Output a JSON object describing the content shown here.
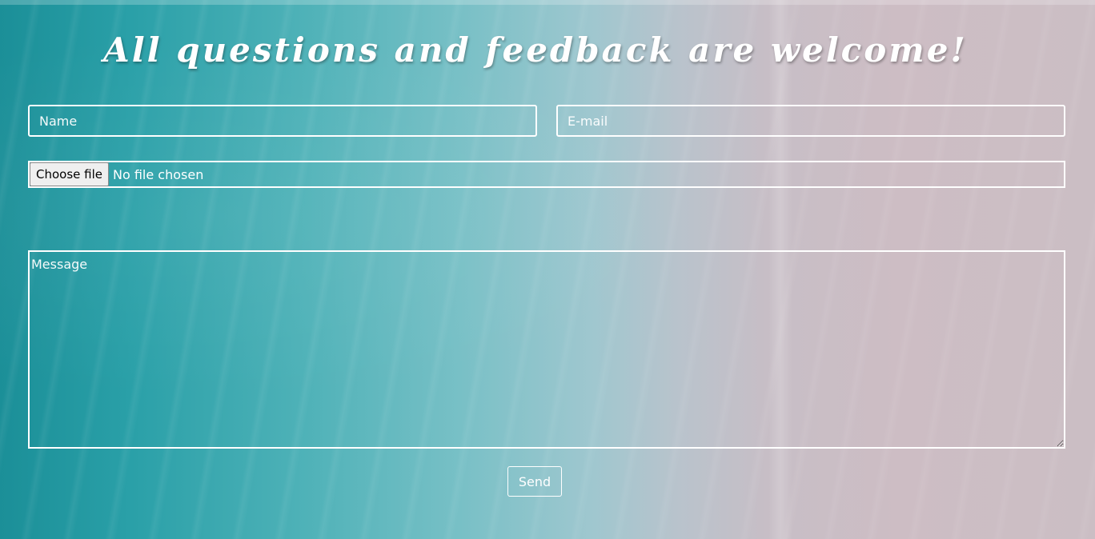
{
  "page": {
    "title": "All questions and feedback are welcome!"
  },
  "form": {
    "name": {
      "placeholder": "Name",
      "value": ""
    },
    "email": {
      "placeholder": "E-mail",
      "value": ""
    },
    "file": {
      "button_label": "Choose file",
      "status": "No file chosen"
    },
    "message": {
      "placeholder": "Message",
      "value": ""
    },
    "send_label": "Send"
  },
  "colors": {
    "text": "#ffffff",
    "border": "#ffffff",
    "ocean": "#2aa0a8",
    "sand": "#cdbdc4"
  }
}
